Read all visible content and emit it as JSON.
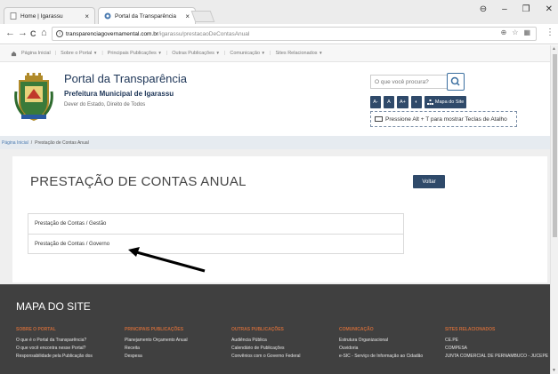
{
  "browser": {
    "tabs": [
      {
        "title": "Home | Igarassu",
        "active": false
      },
      {
        "title": "Portal da Transparência",
        "active": true
      }
    ],
    "tab_close": "×",
    "window_controls": {
      "profile": "⊖",
      "minimize": "–",
      "maximize": "❐",
      "close": "✕"
    },
    "nav": {
      "back": "←",
      "forward": "→",
      "reload": "C",
      "home": "⌂"
    },
    "url_host": "transparenciagovernamental.com.br",
    "url_path": "/igarassu/prestacaoDeContasAnual",
    "omni_icons": {
      "zoom": "⊕",
      "star": "☆",
      "ext": "▦"
    },
    "menu": "⋮"
  },
  "site_nav": {
    "home": "Página Inicial",
    "items": [
      "Sobre o Portal",
      "Principais Publicações",
      "Outras Publicações",
      "Comunicação",
      "Sites Relacionados"
    ],
    "caret": "▼"
  },
  "header": {
    "title": "Portal da Transparência",
    "subtitle": "Prefeitura Municipal de Igarassu",
    "motto": "Dever do Estado, Direito de Todos",
    "search_placeholder": "O que você procura?",
    "font_buttons": [
      "A-",
      "A",
      "A+"
    ],
    "contrast_label": "◐",
    "sitemap_label": "Mapa do Site",
    "shortcut_text": "Pressione Alt + T para mostrar Teclas de Atalho"
  },
  "breadcrumb": {
    "home": "Página Inicial",
    "separator": "/",
    "current": "Prestação de Contas Anual"
  },
  "main": {
    "heading": "PRESTAÇÃO DE CONTAS ANUAL",
    "back_label": "Voltar",
    "items": [
      "Prestação de Contas / Gestão",
      "Prestação de Contas / Governo"
    ]
  },
  "footer": {
    "title": "MAPA DO SITE",
    "columns": [
      {
        "heading": "SOBRE O PORTAL",
        "links": [
          "O que é o Portal da Transparência?",
          "O que você encontra nesse Portal?",
          "Responsabilidade pela Publicação dos"
        ]
      },
      {
        "heading": "PRINCIPAIS PUBLICAÇÕES",
        "links": [
          "Planejamento Orçamento Anual",
          "Receita",
          "Despesa"
        ]
      },
      {
        "heading": "OUTRAS PUBLICAÇÕES",
        "links": [
          "Audiência Pública",
          "Calendário de Publicações",
          "Convênios com o Governo Federal"
        ]
      },
      {
        "heading": "COMUNICAÇÃO",
        "links": [
          "Estrutura Organizacional",
          "Ouvidoria",
          "e-SIC - Serviço de Informação ao Cidadão"
        ]
      },
      {
        "heading": "SITES RELACIONADOS",
        "links": [
          "CE.PE",
          "COMPESA",
          "JUNTA COMERCIAL DE PERNAMBUCO - JUCEPE"
        ]
      }
    ]
  },
  "colors": {
    "brand_dark": "#2f4a6a",
    "footer_bg": "#404040",
    "footer_heading": "#c86a3a",
    "link": "#4a7ab0"
  }
}
